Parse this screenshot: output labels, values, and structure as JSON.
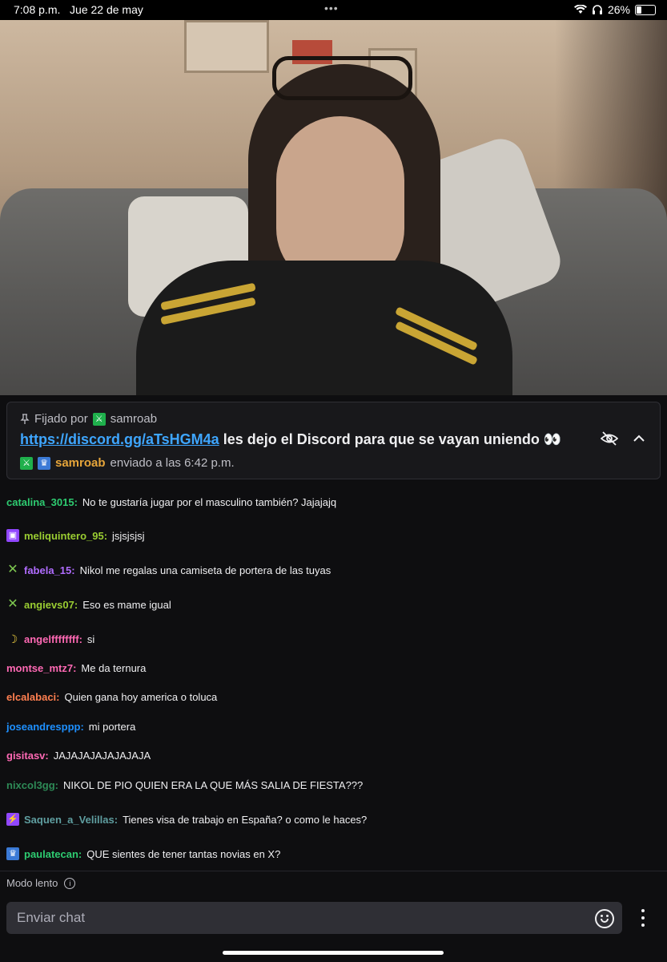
{
  "status_bar": {
    "time": "7:08 p.m.",
    "date": "Jue 22 de may",
    "dots": "•••",
    "battery": "26%",
    "battery_level": 0.26
  },
  "pinned": {
    "pinned_by_label": "Fijado por",
    "pinned_by_user": "samroab",
    "link": "https://discord.gg/aTsHGM4a",
    "text": " les dejo el Discord para que se vayan uniendo 👀",
    "sender": "samroab",
    "sent_label": "enviado a las 6:42 p.m."
  },
  "chat": {
    "messages": [
      {
        "user": "catalina_3015:",
        "text": "No te gustaría jugar por el masculino también? Jajajajq",
        "color": "#2ecc71",
        "badge": ""
      },
      {
        "user": "meliquintero_95:",
        "text": "jsjsjsjsj",
        "color": "#9acd32",
        "badge": "sub-icon"
      },
      {
        "user": "fabela_15:",
        "text": "Nikol me regalas una camiseta de portera de las tuyas",
        "color": "#b06cff",
        "badge": "x-icon"
      },
      {
        "user": "angievs07:",
        "text": "Eso es mame igual",
        "color": "#9acd32",
        "badge": "x-icon"
      },
      {
        "user": "angelffffffff:",
        "text": "si",
        "color": "#ff69b4",
        "badge": "banana-icon"
      },
      {
        "user": "montse_mtz7:",
        "text": "Me da ternura",
        "color": "#ff69b4",
        "badge": ""
      },
      {
        "user": "elcalabaci:",
        "text": "Quien gana hoy america o toluca",
        "color": "#ff7f50",
        "badge": ""
      },
      {
        "user": "joseandresppp:",
        "text": "mi portera",
        "color": "#1e90ff",
        "badge": ""
      },
      {
        "user": "gisitasv:",
        "text": "JAJAJAJAJAJAJAJA",
        "color": "#ff69b4",
        "badge": ""
      },
      {
        "user": "nixcol3gg:",
        "text": "NIKOL DE PIO QUIEN ERA LA QUE MÁS SALIA DE FIESTA???",
        "color": "#2e8b57",
        "badge": ""
      },
      {
        "user": "Saquen_a_Velillas:",
        "text": "Tienes visa de trabajo en España? o como le haces?",
        "color": "#5f9ea0",
        "badge": "bits-icon"
      },
      {
        "user": "paulatecan:",
        "text": "QUE sientes de tener tantas novias en X?",
        "color": "#2ecc71",
        "badge": "vip-icon"
      }
    ]
  },
  "slow_mode": "Modo lento",
  "chat_input": {
    "placeholder": "Enviar chat"
  }
}
